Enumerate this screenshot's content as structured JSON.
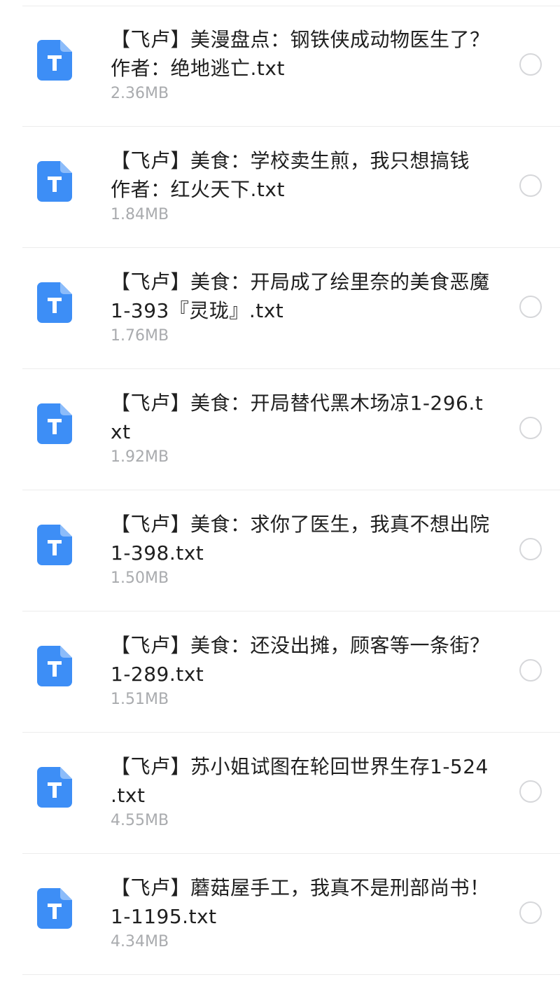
{
  "files": [
    {
      "name": "【飞卢】美漫盘点：钢铁侠成动物医生了？ 作者：绝地逃亡.txt",
      "size": "2.36MB",
      "icon": "txt-file-icon",
      "selected": false
    },
    {
      "name": "【飞卢】美食：学校卖生煎，我只想搞钱 作者：红火天下.txt",
      "size": "1.84MB",
      "icon": "txt-file-icon",
      "selected": false
    },
    {
      "name": "【飞卢】美食：开局成了绘里奈的美食恶魔1-393『灵珑』.txt",
      "size": "1.76MB",
      "icon": "txt-file-icon",
      "selected": false
    },
    {
      "name": "【飞卢】美食：开局替代黑木场凉1-296.txt",
      "size": "1.92MB",
      "icon": "txt-file-icon",
      "selected": false
    },
    {
      "name": "【飞卢】美食：求你了医生，我真不想出院1-398.txt",
      "size": "1.50MB",
      "icon": "txt-file-icon",
      "selected": false
    },
    {
      "name": "【飞卢】美食：还没出摊，顾客等一条街？1-289.txt",
      "size": "1.51MB",
      "icon": "txt-file-icon",
      "selected": false
    },
    {
      "name": "【飞卢】苏小姐试图在轮回世界生存1-524 .txt",
      "size": "4.55MB",
      "icon": "txt-file-icon",
      "selected": false
    },
    {
      "name": "【飞卢】蘑菇屋手工，我真不是刑部尚书！1-1195.txt",
      "size": "4.34MB",
      "icon": "txt-file-icon",
      "selected": false
    }
  ],
  "colors": {
    "icon_blue": "#3d8ef6",
    "icon_fold": "#8cbcfa",
    "text": "#1f1f1f",
    "subtext": "#a9abae",
    "radio_border": "#d6d7da",
    "divider": "#ececec"
  }
}
